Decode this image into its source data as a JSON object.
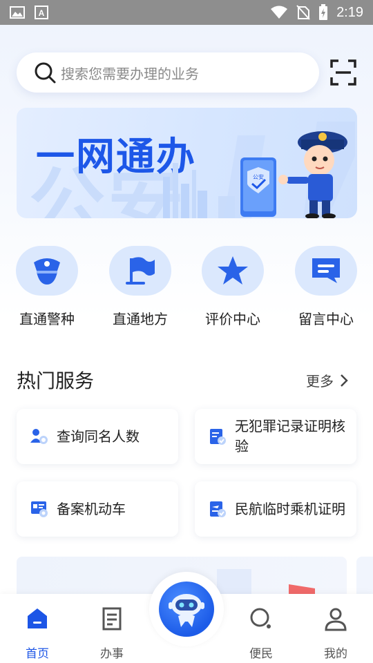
{
  "status_bar": {
    "time": "2:19",
    "left_icons": [
      "gallery-icon",
      "font-icon"
    ],
    "right_icons": [
      "wifi-icon",
      "no-sim-icon",
      "battery-charging-icon"
    ]
  },
  "search": {
    "placeholder": "搜索您需要办理的业务",
    "scan_icon": "scan-icon"
  },
  "banner": {
    "title": "一网通办",
    "watermark": "公安",
    "phone_shield_text": "公安"
  },
  "quick_links": [
    {
      "label": "直通警种",
      "icon": "police-cap-icon"
    },
    {
      "label": "直通地方",
      "icon": "flag-icon"
    },
    {
      "label": "评价中心",
      "icon": "star-icon"
    },
    {
      "label": "留言中心",
      "icon": "message-icon"
    }
  ],
  "hot_services": {
    "title": "热门服务",
    "more_label": "更多",
    "items": [
      {
        "label": "查询同名人数",
        "icon": "people-search-icon"
      },
      {
        "label": "无犯罪记录证明核验",
        "icon": "certificate-check-icon"
      },
      {
        "label": "备案机动车",
        "icon": "vehicle-register-icon"
      },
      {
        "label": "民航临时乘机证明",
        "icon": "flight-certificate-icon"
      }
    ]
  },
  "tab_bar": {
    "tabs": [
      {
        "label": "首页",
        "icon": "home-icon",
        "active": true
      },
      {
        "label": "办事",
        "icon": "document-icon",
        "active": false
      },
      {
        "label": "便民",
        "icon": "search-circle-icon",
        "active": false
      },
      {
        "label": "我的",
        "icon": "user-icon",
        "active": false
      }
    ],
    "center_icon": "robot-assistant-icon"
  },
  "colors": {
    "accent": "#1c55e6",
    "quick_circle_bg": "#dbe8fd",
    "status_bar_bg": "#8e8e8e"
  }
}
